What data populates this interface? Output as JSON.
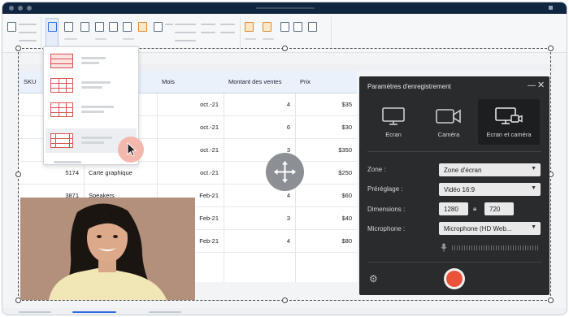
{
  "panel": {
    "title": "Paramètres d'enregistrement",
    "modes": [
      "Ecran",
      "Caméra",
      "Ecran et caméra"
    ],
    "active_mode": "Ecran et caméra",
    "zone_label": "Zone :",
    "zone_value": "Zone d'écran",
    "preset_label": "Préréglage :",
    "preset_value": "Vidéo 16:9",
    "dimensions_label": "Dimensions :",
    "width_value": "1280",
    "height_value": "720",
    "microphone_label": "Microphone :",
    "microphone_value": "Microphone (HD Web..."
  },
  "grid": {
    "headers": [
      "SKU",
      "",
      "Mois",
      "Montant des ventes",
      "Prix"
    ],
    "rows": [
      {
        "sku": "",
        "product": "",
        "month": "oct.-21",
        "amount": "4",
        "price": "$35"
      },
      {
        "sku": "",
        "product": "",
        "month": "oct.-21",
        "amount": "6",
        "price": "$30"
      },
      {
        "sku": "",
        "product": "",
        "month": "oct.-21",
        "amount": "3",
        "price": "$350"
      },
      {
        "sku": "5174",
        "product": "Carte graphique",
        "month": "oct.-21",
        "amount": "3",
        "price": "$250"
      },
      {
        "sku": "3871",
        "product": "Speakers",
        "month": "Feb-21",
        "amount": "4",
        "price": "$60"
      },
      {
        "sku": "",
        "product": "",
        "month": "Feb-21",
        "amount": "3",
        "price": "$40"
      },
      {
        "sku": "",
        "product": "",
        "month": "Feb-21",
        "amount": "4",
        "price": "$80"
      }
    ]
  },
  "colors": {
    "titlebar": "#0f2540",
    "panel_bg": "#2a2b2d",
    "record": "#e8533a",
    "accent": "#2d6cdf",
    "cursor_highlight": "#f4b7ad",
    "table_header": "#eaf1fb"
  },
  "icons": {
    "monitor": "monitor-icon",
    "camera": "camera-icon",
    "monitor_camera": "monitor-camera-icon",
    "move": "move-icon",
    "settings": "gear-icon",
    "microphone": "microphone-icon",
    "lock": "lock-icon",
    "record": "record-icon"
  }
}
